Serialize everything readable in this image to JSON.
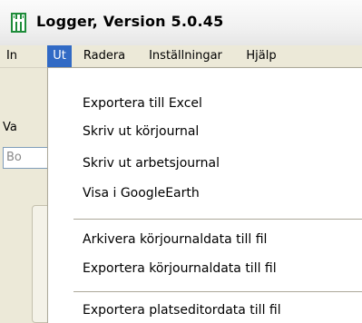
{
  "window": {
    "title": "Logger, Version 5.0.45",
    "icon": "logger-app-icon"
  },
  "menubar": {
    "items": [
      {
        "label": "In"
      },
      {
        "label": "Ut"
      },
      {
        "label": "Radera"
      },
      {
        "label": "Inställningar"
      },
      {
        "label": "Hjälp"
      }
    ],
    "active": "Ut"
  },
  "background": {
    "label_fragment": "Va",
    "input_fragment": "Bo"
  },
  "dropdown": {
    "groups": [
      {
        "items": [
          {
            "label": "Exportera till Excel"
          },
          {
            "label": "Skriv ut körjournal"
          },
          {
            "label": "Skriv ut arbetsjournal"
          },
          {
            "label": "Visa i GoogleEarth"
          }
        ]
      },
      {
        "items": [
          {
            "label": "Arkivera körjournaldata till fil"
          },
          {
            "label": "Exportera körjournaldata till fil"
          }
        ]
      },
      {
        "items": [
          {
            "label": "Exportera platseditordata till fil"
          }
        ]
      }
    ]
  },
  "colors": {
    "menu_highlight": "#316ac5",
    "app_icon_green": "#1e8c3a"
  }
}
